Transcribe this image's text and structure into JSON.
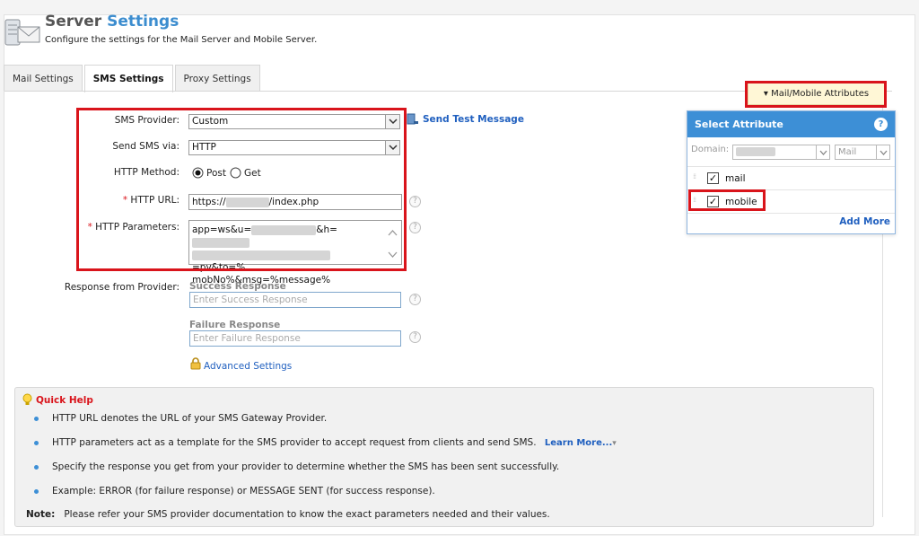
{
  "header": {
    "title_part1": "Server",
    "title_part2": "Settings",
    "subtitle": "Configure the settings for the Mail Server and Mobile Server."
  },
  "tabs": [
    {
      "label": "Mail Settings"
    },
    {
      "label": "SMS Settings",
      "active": true
    },
    {
      "label": "Proxy Settings"
    }
  ],
  "form": {
    "sms_provider": {
      "label": "SMS Provider:",
      "value": "Custom"
    },
    "send_test_label": "Send Test Message",
    "send_via": {
      "label": "Send SMS via:",
      "value": "HTTP"
    },
    "http_method": {
      "label": "HTTP Method:",
      "options": [
        "Post",
        "Get"
      ],
      "selected": "Post"
    },
    "http_url": {
      "label": "HTTP URL:",
      "value_prefix": "https://",
      "value_suffix": "/index.php"
    },
    "http_params": {
      "label": "HTTP Parameters:",
      "line1_a": "app=ws&u=",
      "line1_b": "&h=",
      "line2_b": "=pv&to=%",
      "line3": "mobNo%&msg=%message%"
    },
    "response": {
      "label": "Response from Provider:",
      "success_label": "Success Response",
      "success_placeholder": "Enter Success Response",
      "failure_label": "Failure Response",
      "failure_placeholder": "Enter Failure Response"
    },
    "advanced_label": "Advanced Settings",
    "required_mark": "*",
    "help_mark": "?"
  },
  "attributes": {
    "button_label": "Mail/Mobile Attributes",
    "panel_title": "Select Attribute",
    "domain_label": "Domain:",
    "type_value": "Mail",
    "items": [
      {
        "label": "mail",
        "checked": true
      },
      {
        "label": "mobile",
        "checked": true
      }
    ],
    "add_more": "Add More"
  },
  "quick_help": {
    "title": "Quick Help",
    "items": [
      "HTTP URL denotes the URL of your SMS Gateway Provider.",
      "HTTP parameters act as a template for the SMS provider to accept request from clients and send SMS.",
      "Specify the response you get from your provider to determine whether the SMS has been sent successfully.",
      "Example: ERROR (for failure response) or MESSAGE SENT (for success response)."
    ],
    "learn_more": "Learn More...",
    "note_label": "Note:",
    "note_text": "Please refer your SMS provider documentation to know the exact parameters needed and their values."
  },
  "colors": {
    "accent": "#3d8fd6",
    "highlight": "#d9141b",
    "link": "#1f5fbf"
  }
}
